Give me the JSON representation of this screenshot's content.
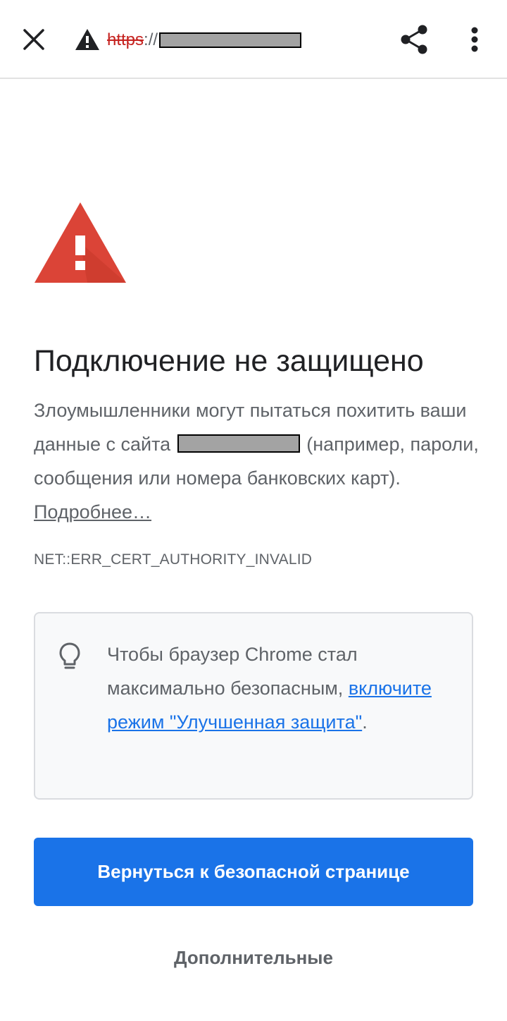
{
  "toolbar": {
    "url_scheme": "https",
    "url_separator": "://",
    "close_icon": "close-icon",
    "security_icon": "warning-triangle-icon",
    "share_icon": "share-icon",
    "menu_icon": "more-vert-icon"
  },
  "interstitial": {
    "warning_icon": "warning-triangle-icon",
    "title": "Подключение не защищено",
    "description_part1": "Злоумышленники могут пытаться похитить ваши данные с сайта",
    "description_part2": "(например, пароли, сообщения или номера банковских карт).",
    "learn_more_link": "Подробнее…",
    "error_code": "NET::ERR_CERT_AUTHORITY_INVALID"
  },
  "tip": {
    "icon": "lightbulb-icon",
    "text": "Чтобы браузер Chrome стал максимально безопасным,",
    "link": "включите режим \"Улучшенная защита\"",
    "trailing": "."
  },
  "actions": {
    "back_to_safety": "Вернуться к безопасной странице",
    "advanced": "Дополнительные"
  },
  "colors": {
    "danger": "#d93025",
    "accent": "#1a73e8",
    "secondary_text": "#5f6368",
    "redaction": "#a3a3a3"
  }
}
